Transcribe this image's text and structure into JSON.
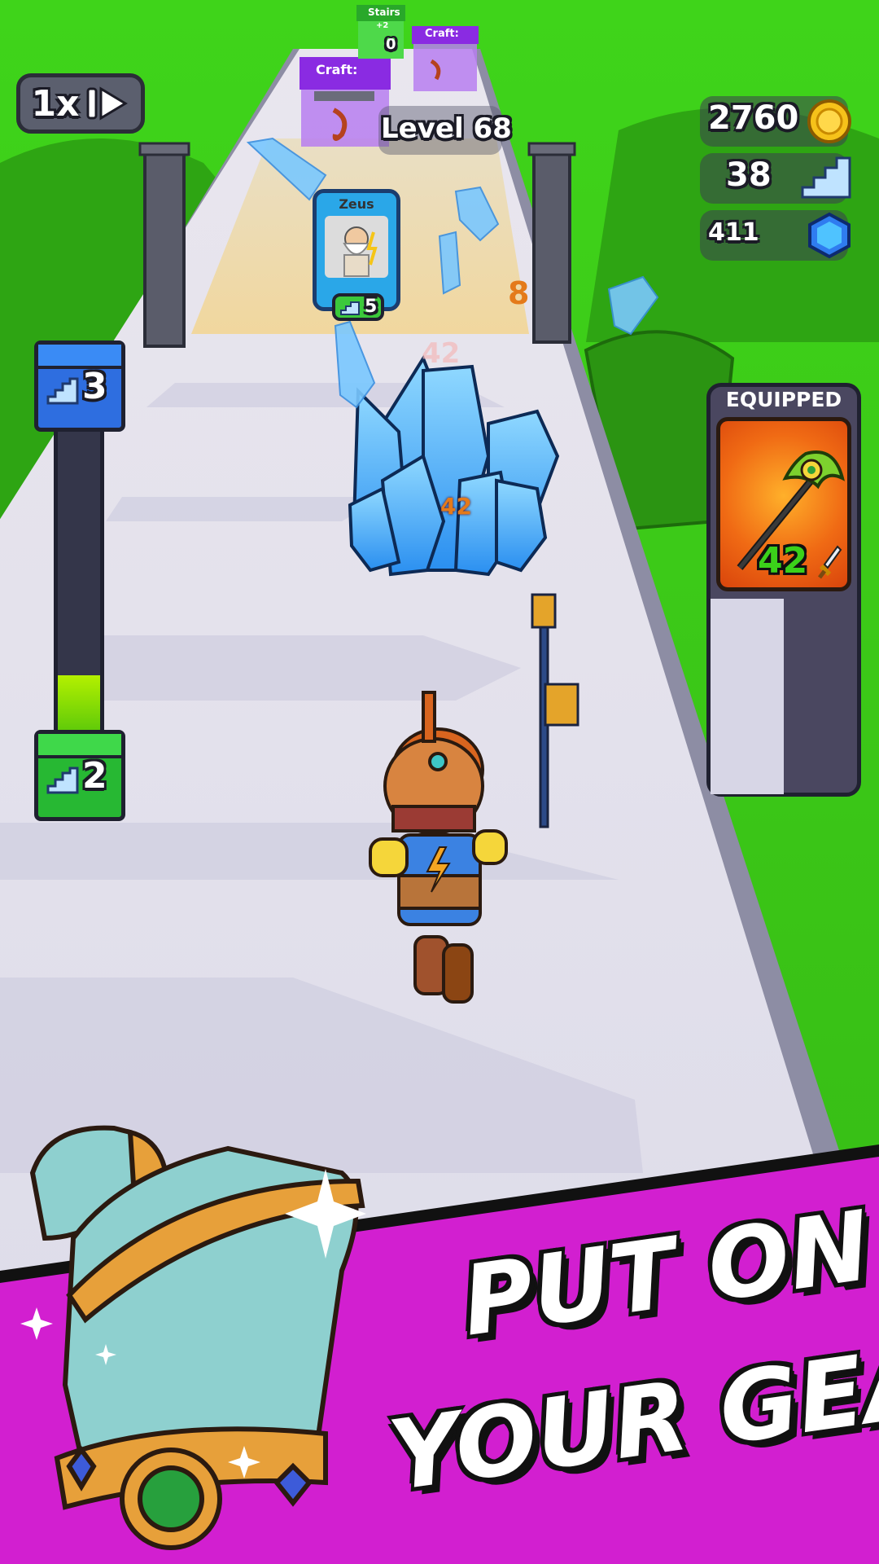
{
  "hud": {
    "speed_label": "1x",
    "level_label": "Level 68",
    "coins": "2760",
    "stairs": "38",
    "gems": "411"
  },
  "stair_meter": {
    "top_value": "3",
    "bottom_value": "2",
    "progress_fraction": 0.2
  },
  "track": {
    "gates": [
      {
        "label": "Stairs",
        "sub": "+2",
        "value": "0"
      },
      {
        "label": "Craft:"
      },
      {
        "label": "Craft:"
      }
    ],
    "card": {
      "name": "Zeus",
      "cost": "5"
    },
    "crystal_hp": "42",
    "crystal_hp_ghost": "42",
    "side_number": "8"
  },
  "equipped": {
    "title": "EQUIPPED",
    "weapon_power": "42",
    "icon": "green-axe-staff-icon"
  },
  "promo": {
    "line1": "PUT ON",
    "line2": "YOUR GEAR!",
    "colors": {
      "banner": "#d21fd0",
      "text": "#ffffff"
    }
  }
}
